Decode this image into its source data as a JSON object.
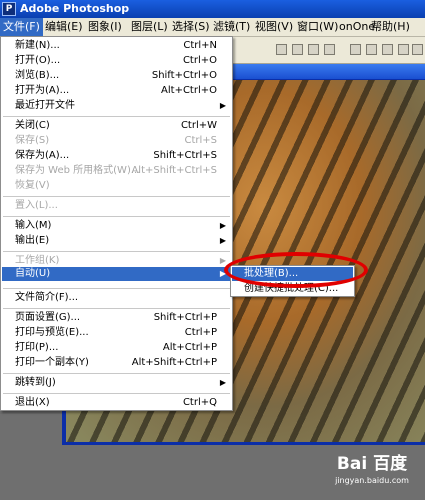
{
  "window": {
    "title": "Adobe Photoshop",
    "icon": "ps-icon"
  },
  "menubar": [
    {
      "label": "文件(F)",
      "active": true
    },
    {
      "label": "编辑(E)"
    },
    {
      "label": "图象(I)"
    },
    {
      "label": "图层(L)"
    },
    {
      "label": "选择(S)"
    },
    {
      "label": "滤镜(T)"
    },
    {
      "label": "视图(V)"
    },
    {
      "label": "窗口(W)"
    },
    {
      "label": "onOne"
    },
    {
      "label": "帮助(H)"
    }
  ],
  "file_menu": {
    "items": [
      {
        "label": "新建(N)...",
        "shortcut": "Ctrl+N"
      },
      {
        "label": "打开(O)...",
        "shortcut": "Ctrl+O"
      },
      {
        "label": "浏览(B)...",
        "shortcut": "Shift+Ctrl+O"
      },
      {
        "label": "打开为(A)...",
        "shortcut": "Alt+Ctrl+O"
      },
      {
        "label": "最近打开文件",
        "arrow": "▶"
      },
      {
        "label": "关闭(C)",
        "shortcut": "Ctrl+W"
      },
      {
        "label": "保存(S)",
        "shortcut": "Ctrl+S",
        "disabled": true
      },
      {
        "label": "保存为(A)...",
        "shortcut": "Shift+Ctrl+S"
      },
      {
        "label": "保存为 Web 所用格式(W)...",
        "shortcut": "Alt+Shift+Ctrl+S",
        "disabled": true
      },
      {
        "label": "恢复(V)",
        "disabled": true
      },
      {
        "label": "置入(L)...",
        "disabled": true
      },
      {
        "label": "输入(M)",
        "arrow": "▶"
      },
      {
        "label": "输出(E)",
        "arrow": "▶"
      },
      {
        "label": "工作组(K)",
        "arrow": "▶",
        "disabled": true
      },
      {
        "label": "自动(U)",
        "arrow": "▶",
        "highlight": true
      },
      {
        "label": "文件简介(F)..."
      },
      {
        "label": "页面设置(G)...",
        "shortcut": "Shift+Ctrl+P"
      },
      {
        "label": "打印与预览(E)...",
        "shortcut": "Ctrl+P"
      },
      {
        "label": "打印(P)...",
        "shortcut": "Alt+Ctrl+P"
      },
      {
        "label": "打印一个副本(Y)",
        "shortcut": "Alt+Shift+Ctrl+P"
      },
      {
        "label": "跳转到(J)",
        "arrow": "▶"
      },
      {
        "label": "退出(X)",
        "shortcut": "Ctrl+Q"
      }
    ]
  },
  "auto_submenu": {
    "items": [
      {
        "label": "批处理(B)...",
        "highlight": true
      },
      {
        "label": "创建快捷批处理(C)..."
      }
    ]
  },
  "annotation": {
    "color": "#e00000"
  },
  "watermark": {
    "logo": "Bai 百度",
    "url": "jingyan.baidu.com"
  },
  "colors": {
    "highlight": "#316ac5",
    "titlebar": "#0a3fb0",
    "menubar": "#ece9d8"
  }
}
